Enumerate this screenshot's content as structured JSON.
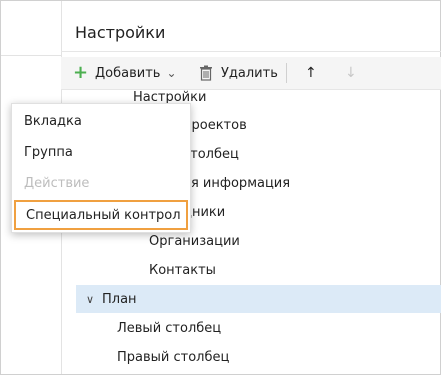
{
  "header": {
    "title": "Настройки"
  },
  "toolbar": {
    "add_label": "Добавить",
    "delete_label": "Удалить",
    "up_icon": "↑",
    "down_icon": "↓"
  },
  "tree": {
    "rows": [
      {
        "label": "Настройки"
      },
      {
        "label": "проектов"
      },
      {
        "label": "столбец"
      },
      {
        "label": "ая информация"
      },
      {
        "label": "дники"
      },
      {
        "label": "Организации"
      },
      {
        "label": "Контакты"
      },
      {
        "label": "План",
        "toggle": "∨"
      },
      {
        "label": "Левый столбец"
      },
      {
        "label": "Правый столбец"
      }
    ]
  },
  "menu": {
    "items": [
      {
        "label": "Вкладка"
      },
      {
        "label": "Группа"
      },
      {
        "label": "Действие"
      },
      {
        "label": "Специальный контрол"
      }
    ]
  },
  "colors": {
    "accent_add": "#4caf50",
    "selected_row": "#dceaf7",
    "highlight_outline": "#f0a040"
  }
}
